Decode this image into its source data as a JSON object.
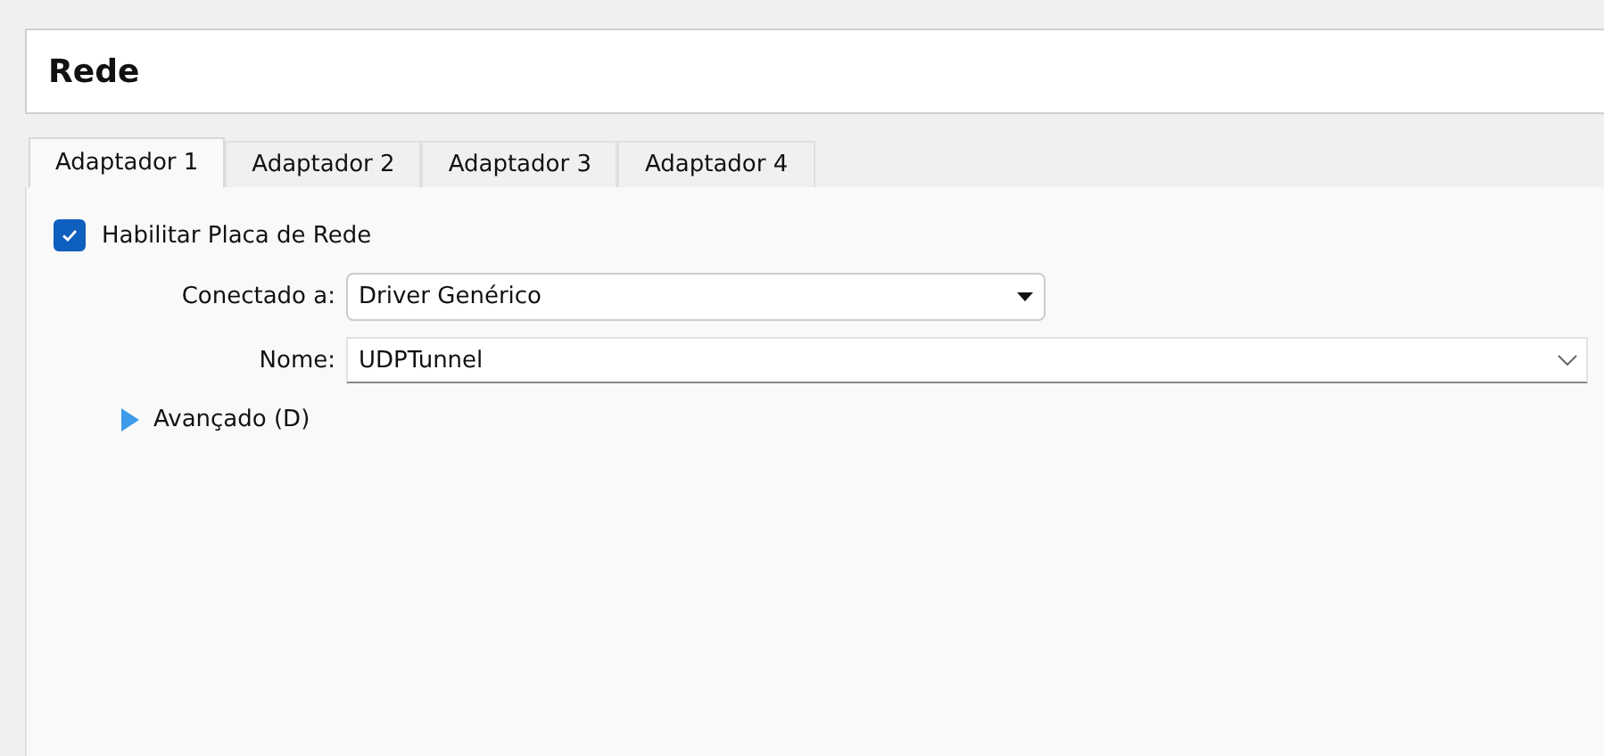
{
  "header": {
    "title": "Rede"
  },
  "tabs": [
    {
      "label": "Adaptador 1",
      "selected": true
    },
    {
      "label": "Adaptador 2",
      "selected": false
    },
    {
      "label": "Adaptador 3",
      "selected": false
    },
    {
      "label": "Adaptador 4",
      "selected": false
    }
  ],
  "enable": {
    "label": "Habilitar Placa de Rede",
    "checked": true
  },
  "fields": [
    {
      "kind": "combo",
      "label": "Conectado a:",
      "value": "Driver Genérico"
    },
    {
      "kind": "editable",
      "label": "Nome:",
      "value": "UDPTunnel"
    }
  ],
  "advanced": {
    "label": "Avançado (D)",
    "expanded": false
  }
}
